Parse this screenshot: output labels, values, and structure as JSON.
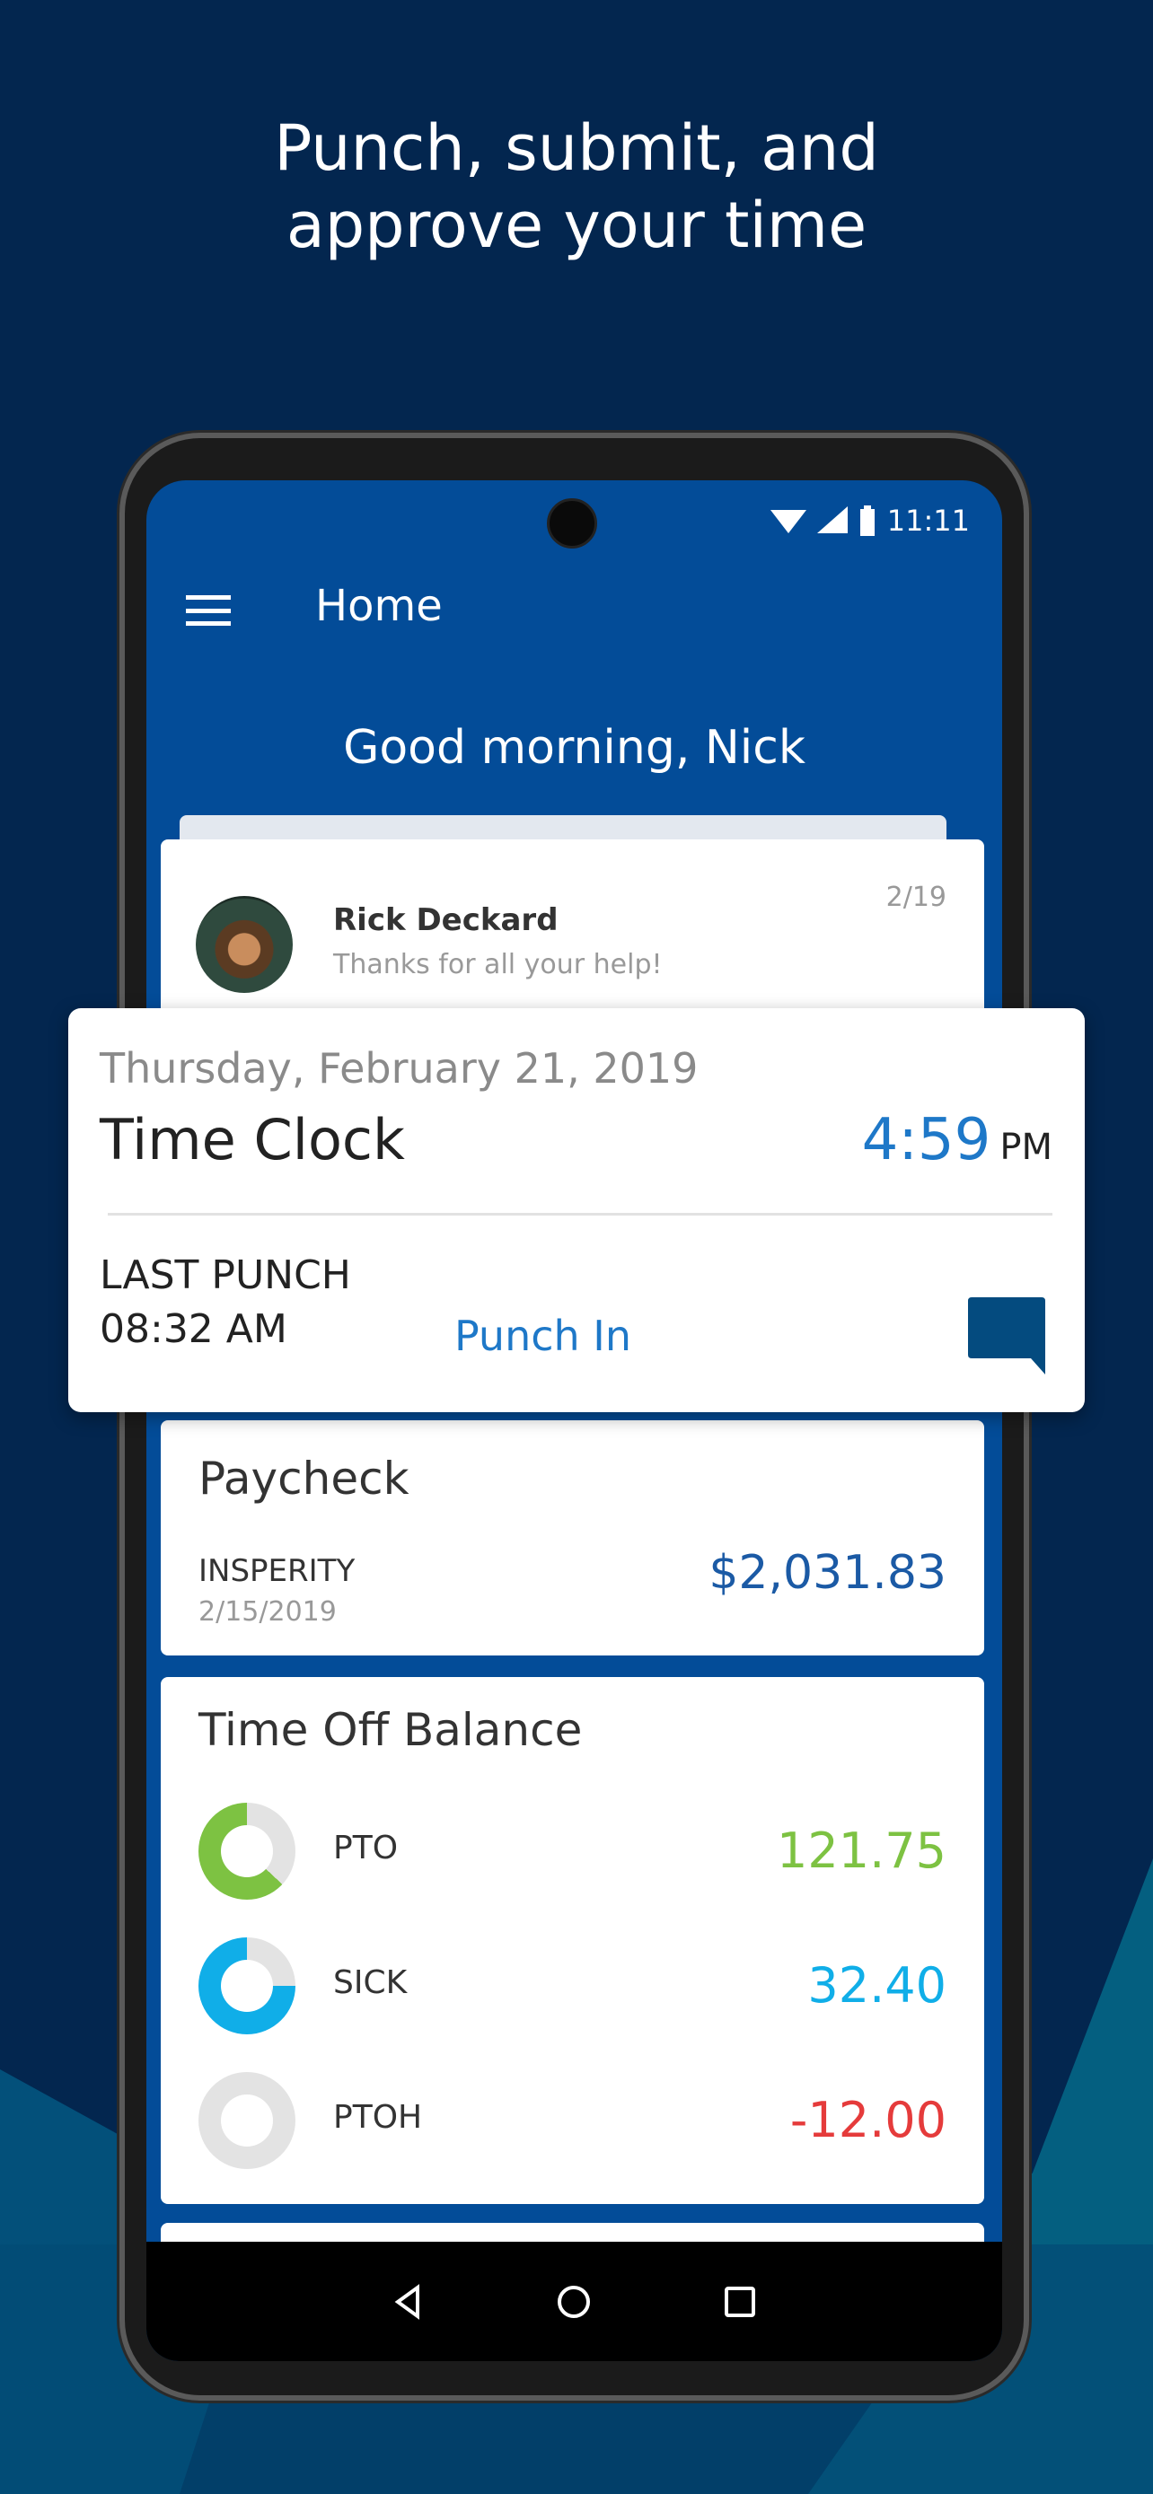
{
  "headline": [
    "Punch, submit, and",
    "approve your time"
  ],
  "status_bar": {
    "time": "11:11",
    "icons": [
      "wifi-icon",
      "signal-icon",
      "battery-icon"
    ]
  },
  "app_bar": {
    "title": "Home",
    "menu_icon": "hamburger-menu-icon"
  },
  "greeting": "Good morning, Nick",
  "message": {
    "name": "Rick Deckard",
    "text": "Thanks for all your help!",
    "date": "2/19"
  },
  "time_clock": {
    "date": "Thursday, February 21, 2019",
    "title": "Time Clock",
    "time": "4:59",
    "ampm": "PM",
    "last_punch_label": "LAST PUNCH",
    "last_punch_time": "08:32 AM",
    "action": "Punch In",
    "chat_icon": "chat-bubble-icon"
  },
  "paycheck": {
    "title": "Paycheck",
    "company": "INSPERITY",
    "date": "2/15/2019",
    "amount": "$2,031.83"
  },
  "time_off": {
    "title": "Time Off Balance",
    "items": [
      {
        "label": "PTO",
        "value": "121.75",
        "color": "#7dc242",
        "fill": 0.63
      },
      {
        "label": "SICK",
        "value": "32.40",
        "color": "#10aee8",
        "fill": 0.75
      },
      {
        "label": "PTOH",
        "value": "-12.00",
        "color": "#e53b3b",
        "fill": 0
      }
    ]
  },
  "colors": {
    "background": "#03264f",
    "app_blue": "#034c98",
    "link_blue": "#1e78c8",
    "amount_blue": "#1b5aa5"
  }
}
